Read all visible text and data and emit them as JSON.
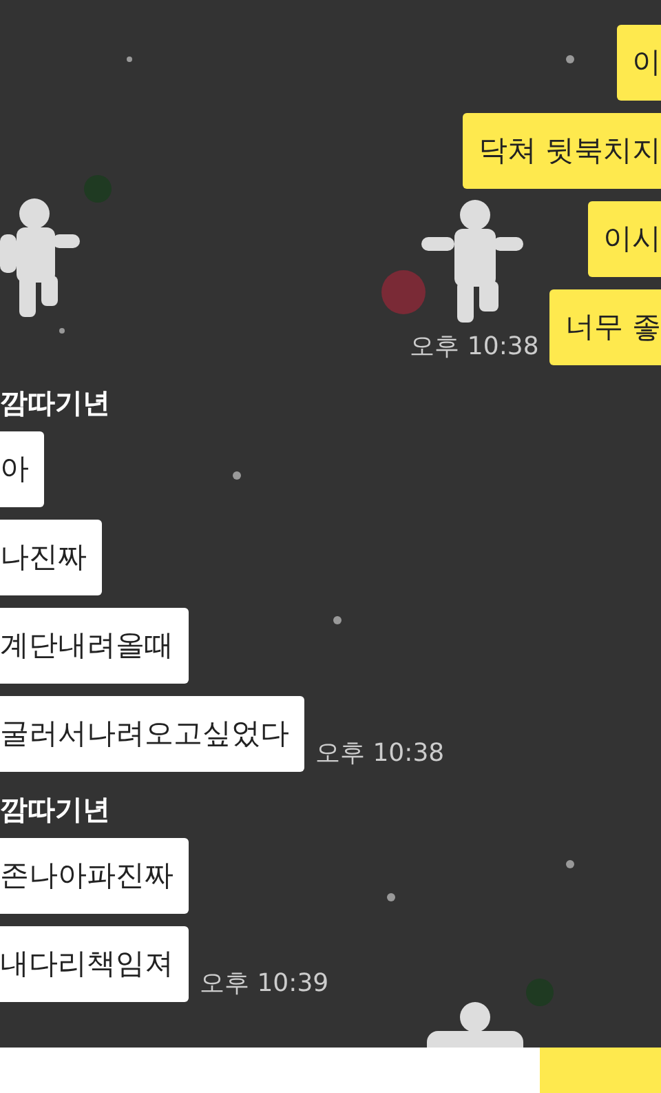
{
  "sent": {
    "messages": [
      "이",
      "닥쳐 뒷북치지",
      "이시",
      "너무 좋"
    ],
    "time": "오후 10:38"
  },
  "received": [
    {
      "sender": "깜따기년",
      "messages": [
        "아",
        "나진짜",
        "계단내려올때",
        "굴러서나려오고싶었다"
      ],
      "time": "오후 10:38"
    },
    {
      "sender": "깜따기년",
      "messages": [
        "존나아파진짜",
        "내다리책임져"
      ],
      "time": "오후 10:39"
    }
  ]
}
